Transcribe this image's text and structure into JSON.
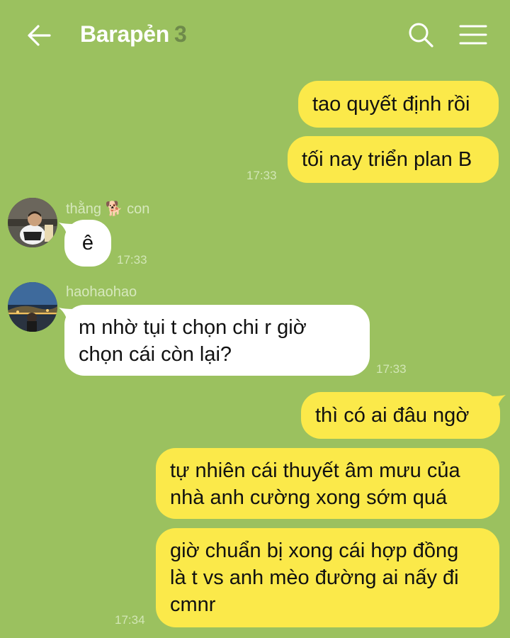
{
  "header": {
    "title": "Barapẻn",
    "member_count": "3",
    "back_icon": "arrow-left-icon",
    "search_icon": "search-icon",
    "menu_icon": "hamburger-menu-icon"
  },
  "colors": {
    "background": "#9bc15f",
    "my_bubble": "#fbe94a",
    "their_bubble": "#ffffff",
    "timestamp": "#d2e6b6"
  },
  "messages": [
    {
      "side": "mine",
      "text": "tao quyết định rồi"
    },
    {
      "side": "mine",
      "text": "tối nay triển plan B",
      "time": "17:33"
    },
    {
      "side": "theirs",
      "sender": "thằng",
      "sender_emoji": "🐕",
      "sender_suffix": "con",
      "text": "ê",
      "time": "17:33"
    },
    {
      "side": "theirs",
      "sender": "haohaohao",
      "lines": [
        "m nhờ tụi t chọn chi r giờ",
        "chọn cái còn lại?"
      ],
      "time": "17:33"
    },
    {
      "side": "mine",
      "text": "thì có ai đâu ngờ"
    },
    {
      "side": "mine",
      "lines": [
        "tự nhiên cái thuyết âm mưu của",
        "nhà anh cường xong sớm quá"
      ]
    },
    {
      "side": "mine",
      "lines": [
        "giờ chuẩn bị xong cái hợp đồng",
        "là t vs anh mèo đường ai nấy đi",
        "cmnr"
      ],
      "time": "17:34"
    }
  ]
}
